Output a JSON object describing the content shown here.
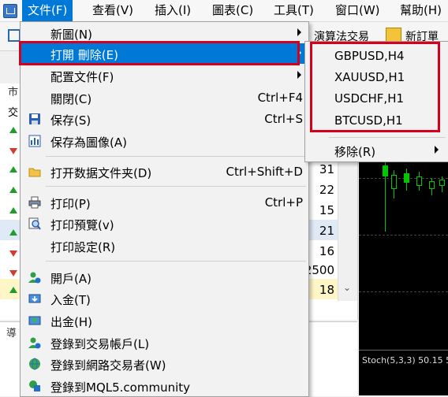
{
  "menubar": {
    "items": [
      {
        "label": "文件(F)",
        "active": true
      },
      {
        "label": "查看(V)"
      },
      {
        "label": "插入(I)"
      },
      {
        "label": "圖表(C)"
      },
      {
        "label": "工具(T)"
      },
      {
        "label": "窗口(W)"
      },
      {
        "label": "幫助(H)"
      }
    ]
  },
  "toolbar": {
    "algo_trading": "演算法交易",
    "new_order": "新訂單"
  },
  "market_watch": {
    "title": "市",
    "header": "交",
    "values": [
      "31",
      "22",
      "15",
      "21",
      "16",
      "2500",
      "18"
    ]
  },
  "navigator": {
    "title": "導"
  },
  "chart": {
    "indicator_label": "Stoch(5,3,3) 50.15 5",
    "colors": {
      "background": "#000000",
      "bull": "#00c800"
    }
  },
  "file_menu": {
    "items": [
      {
        "label": "新圖(N)",
        "shortcut": "",
        "submenu": true
      },
      {
        "label": "打開 刪除(E)",
        "shortcut": "",
        "submenu": true,
        "highlighted": true
      },
      {
        "label": "配置文件(F)",
        "shortcut": "",
        "submenu": true
      },
      {
        "label": "關閉(C)",
        "shortcut": "Ctrl+F4"
      },
      {
        "label": "保存(S)",
        "shortcut": "Ctrl+S",
        "icon": "save-icon"
      },
      {
        "label": "保存為圖像(A)",
        "shortcut": "",
        "icon": "image-save-icon"
      },
      {
        "label": "打开数据文件夹(D)",
        "shortcut": "Ctrl+Shift+D",
        "icon": "folder-icon"
      },
      {
        "label": "打印(P)",
        "shortcut": "Ctrl+P",
        "icon": "printer-icon"
      },
      {
        "label": "打印預覽(v)",
        "shortcut": "",
        "icon": "print-preview-icon"
      },
      {
        "label": "打印設定(R)",
        "shortcut": ""
      },
      {
        "label": "開戶(A)",
        "shortcut": "",
        "icon": "open-account-icon"
      },
      {
        "label": "入金(T)",
        "shortcut": "",
        "icon": "deposit-icon"
      },
      {
        "label": "出金(H)",
        "shortcut": "",
        "icon": "withdraw-icon"
      },
      {
        "label": "登錄到交易帳戶(L)",
        "shortcut": "",
        "icon": "login-account-icon"
      },
      {
        "label": "登錄到網路交易者(W)",
        "shortcut": "",
        "icon": "web-trader-icon"
      },
      {
        "label": "登錄到MQL5.community",
        "shortcut": "",
        "icon": "mql5-icon"
      }
    ]
  },
  "submenu": {
    "items": [
      "GBPUSD,H4",
      "XAUUSD,H1",
      "USDCHF,H1",
      "BTCUSD,H1"
    ],
    "remove": "移除(R)"
  },
  "colors": {
    "highlight": "#0078d7",
    "annotation": "#d6001c",
    "menu_bg": "#f2f2f2"
  }
}
